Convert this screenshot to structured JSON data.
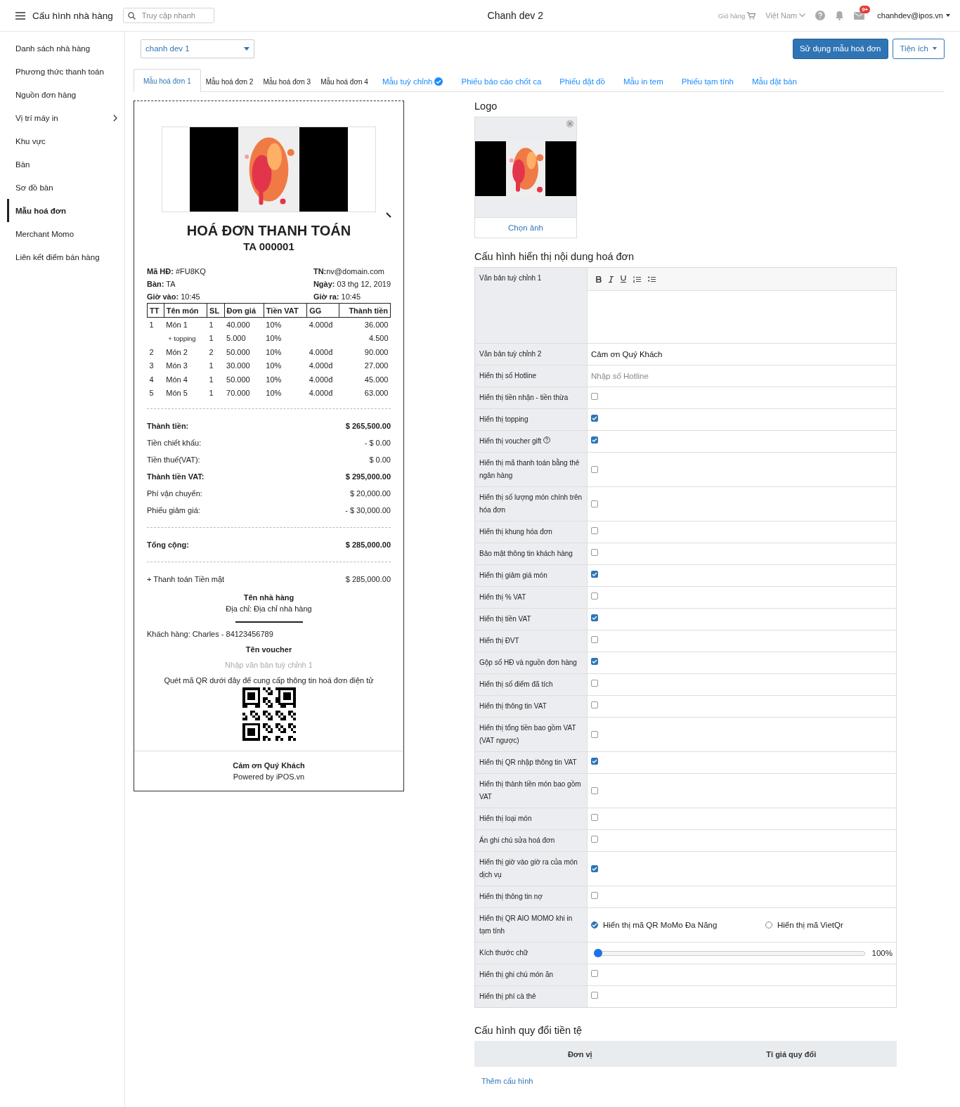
{
  "header": {
    "title": "Cấu hình nhà hàng",
    "search": {
      "placeholder": "Truy cập nhanh"
    },
    "center_title": "Chanh dev 2",
    "cart_label": "Giỏ hàng",
    "language": "Việt Nam",
    "mail_badge": "9+",
    "user": "chanhdev@ipos.vn"
  },
  "sidebar": {
    "items": [
      {
        "label": "Danh sách nhà hàng",
        "selected": false,
        "expandable": false
      },
      {
        "label": "Phương thức thanh toán",
        "selected": false,
        "expandable": false
      },
      {
        "label": "Nguồn đơn hàng",
        "selected": false,
        "expandable": false
      },
      {
        "label": "Vị trí máy in",
        "selected": false,
        "expandable": true
      },
      {
        "label": "Khu vực",
        "selected": false,
        "expandable": false
      },
      {
        "label": "Bàn",
        "selected": false,
        "expandable": false
      },
      {
        "label": "Sơ đồ bàn",
        "selected": false,
        "expandable": false
      },
      {
        "label": "Mẫu hoá đơn",
        "selected": true,
        "expandable": false
      },
      {
        "label": "Merchant Momo",
        "selected": false,
        "expandable": false
      },
      {
        "label": "Liên kết điểm bán hàng",
        "selected": false,
        "expandable": false
      }
    ]
  },
  "toolbar": {
    "store_select": "chanh dev 1",
    "primary_button": "Sử dụng mẫu hoá đơn",
    "utility_button": "Tiện ích"
  },
  "tabs": [
    {
      "label": "Mẫu hoá đơn 1",
      "kind": "template",
      "selected": true,
      "verified": false
    },
    {
      "label": "Mẫu hoá đơn 2",
      "kind": "template",
      "selected": false,
      "verified": false
    },
    {
      "label": "Mẫu hoá đơn 3",
      "kind": "template",
      "selected": false,
      "verified": false
    },
    {
      "label": "Mẫu hoá đơn 4",
      "kind": "template",
      "selected": false,
      "verified": false
    },
    {
      "label": "Mẫu tuỳ chỉnh",
      "kind": "link",
      "selected": false,
      "verified": true
    },
    {
      "label": "Phiếu báo cáo chốt ca",
      "kind": "link",
      "selected": false,
      "verified": false
    },
    {
      "label": "Phiếu đặt đồ",
      "kind": "link",
      "selected": false,
      "verified": false
    },
    {
      "label": "Mẫu in tem",
      "kind": "link",
      "selected": false,
      "verified": false
    },
    {
      "label": "Phiếu tạm tính",
      "kind": "link",
      "selected": false,
      "verified": false
    },
    {
      "label": "Mẫu đặt bàn",
      "kind": "link",
      "selected": false,
      "verified": false
    }
  ],
  "receipt": {
    "title": "HOÁ ĐƠN THANH TOÁN",
    "code": "TA 000001",
    "meta_left": [
      "**Mã HĐ:** #FU8KQ",
      "**Bàn:** TA",
      "**Giờ vào:** 10:45"
    ],
    "meta_right": [
      "**TN:**nv@domain.com",
      "**Ngày:** 03 thg 12, 2019",
      "**Giờ ra:** 10:45"
    ],
    "columns": [
      "TT",
      "Tên món",
      "SL",
      "Đơn giá",
      "Tiền VAT",
      "GG",
      "Thành tiền"
    ],
    "rows": [
      {
        "kind": "item",
        "no": "1",
        "name": "Món 1",
        "qty": "1",
        "price": "40.000",
        "vat": "10%",
        "discount": "4.000đ",
        "total": "36.000"
      },
      {
        "kind": "topping",
        "name": "+ topping",
        "qty": "1",
        "price": "5.000",
        "vat": "10%",
        "total": "4.500"
      },
      {
        "kind": "item",
        "no": "2",
        "name": "Món 2",
        "qty": "2",
        "price": "50.000",
        "vat": "10%",
        "discount": "4.000đ",
        "total": "90.000"
      },
      {
        "kind": "item",
        "no": "3",
        "name": "Món 3",
        "qty": "1",
        "price": "30.000",
        "vat": "10%",
        "discount": "4.000đ",
        "total": "27.000"
      },
      {
        "kind": "item",
        "no": "4",
        "name": "Món 4",
        "qty": "1",
        "price": "50.000",
        "vat": "10%",
        "discount": "4.000đ",
        "total": "45.000"
      },
      {
        "kind": "item",
        "no": "5",
        "name": "Món 5",
        "qty": "1",
        "price": "70.000",
        "vat": "10%",
        "discount": "4.000đ",
        "total": "63.000"
      }
    ],
    "totals": [
      {
        "label": "Thành tiền:",
        "value": "$ 265,500.00",
        "bold": true
      },
      {
        "label": "Tiền chiết khấu:",
        "value": "- $ 0.00",
        "bold": false
      },
      {
        "label": "Tiền thuế(VAT):",
        "value": "$ 0.00",
        "bold": false
      },
      {
        "label": "Thành tiền VAT:",
        "value": "$ 295,000.00",
        "bold": true
      },
      {
        "label": "Phí vận chuyển:",
        "value": "$ 20,000.00",
        "bold": false
      },
      {
        "label": "Phiếu giảm giá:",
        "value": "- $ 30,000.00",
        "bold": false
      }
    ],
    "grand_total": {
      "label": "Tổng cộng:",
      "value": "$ 285,000.00"
    },
    "payment": {
      "label": "+ Thanh toán Tiền mặt",
      "value": "$ 285,000.00"
    },
    "store_name": "Tên nhà hàng",
    "address": "Địa chỉ: Địa chỉ nhà hàng",
    "customer": "Khách hàng: Charles - 84123456789",
    "voucher_name": "Tên voucher",
    "custom_text_placeholder": "Nhập văn bản tuỳ chỉnh 1",
    "qr_caption": "Quét mã QR dưới đây để cung cấp thông tin hoá đơn điện tử",
    "thanks": "Cảm ơn Quý Khách",
    "powered_by": "Powered by iPOS.vn"
  },
  "logo_panel": {
    "heading": "Logo",
    "button": "Chọn ảnh"
  },
  "config": {
    "heading": "Cấu hình hiển thị nội dung hoá đơn",
    "rows": [
      {
        "label": "Văn bản tuỳ chỉnh 1",
        "kind": "editor"
      },
      {
        "label": "Văn bản tuỳ chỉnh 2",
        "kind": "text",
        "value": "Cảm ơn Quý Khách"
      },
      {
        "label": "Hiển thị số Hotline",
        "kind": "input",
        "placeholder": "Nhập số Hotline"
      },
      {
        "label": "Hiển thị tiền nhận - tiền thừa",
        "kind": "checkbox",
        "checked": false,
        "help": false
      },
      {
        "label": "Hiển thị topping",
        "kind": "checkbox",
        "checked": true,
        "help": false
      },
      {
        "label": "Hiển thị voucher gift",
        "kind": "checkbox",
        "checked": true,
        "help": true
      },
      {
        "label": "Hiển thị mã thanh toán bằng thẻ ngân hàng",
        "kind": "checkbox",
        "checked": false,
        "help": false
      },
      {
        "label": "Hiển thị số lượng món chính trên hóa đơn",
        "kind": "checkbox",
        "checked": false,
        "help": false
      },
      {
        "label": "Hiển thị khung hóa đơn",
        "kind": "checkbox",
        "checked": false,
        "help": false
      },
      {
        "label": "Bảo mật thông tin khách hàng",
        "kind": "checkbox",
        "checked": false,
        "help": false
      },
      {
        "label": "Hiển thị giảm giá món",
        "kind": "checkbox",
        "checked": true,
        "help": false
      },
      {
        "label": "Hiển thị % VAT",
        "kind": "checkbox",
        "checked": false,
        "help": false
      },
      {
        "label": "Hiển thị tiền VAT",
        "kind": "checkbox",
        "checked": true,
        "help": false
      },
      {
        "label": "Hiển thị ĐVT",
        "kind": "checkbox",
        "checked": false,
        "help": false
      },
      {
        "label": "Gộp số HĐ và nguồn đơn hàng",
        "kind": "checkbox",
        "checked": true,
        "help": false
      },
      {
        "label": "Hiển thị số điểm đã tích",
        "kind": "checkbox",
        "checked": false,
        "help": false
      },
      {
        "label": "Hiển thị thông tin VAT",
        "kind": "checkbox",
        "checked": false,
        "help": false
      },
      {
        "label": "Hiển thị tổng tiền bao gồm VAT (VAT ngược)",
        "kind": "checkbox",
        "checked": false,
        "help": false
      },
      {
        "label": "Hiển thị QR nhập thông tin VAT",
        "kind": "checkbox",
        "checked": true,
        "help": false
      },
      {
        "label": "Hiển thị thành tiền món bao gồm VAT",
        "kind": "checkbox",
        "checked": false,
        "help": false
      },
      {
        "label": "Hiển thị loại món",
        "kind": "checkbox",
        "checked": false,
        "help": false
      },
      {
        "label": "Ẩn ghi chú sửa hoá đơn",
        "kind": "checkbox",
        "checked": false,
        "help": false
      },
      {
        "label": "Hiển thị giờ vào giờ ra của món dịch vụ",
        "kind": "checkbox",
        "checked": true,
        "help": false
      },
      {
        "label": "Hiển thị thông tin nợ",
        "kind": "checkbox",
        "checked": false,
        "help": false
      },
      {
        "label": "Hiển thị QR AIO MOMO khi in tạm tính",
        "kind": "radio",
        "options": [
          {
            "label": "Hiển thị mã QR MoMo Đa Năng",
            "selected": true
          },
          {
            "label": "Hiển thị mã VietQr",
            "selected": false
          }
        ]
      },
      {
        "label": "Kích thước chữ",
        "kind": "slider",
        "level": 0,
        "reading": "100%"
      },
      {
        "label": "Hiển thị ghi chú món ăn",
        "kind": "checkbox",
        "checked": false,
        "help": false
      },
      {
        "label": "Hiển thị phí cà thẻ",
        "kind": "checkbox",
        "checked": false,
        "help": false
      }
    ]
  },
  "currency": {
    "heading": "Cấu hình quy đổi tiền tệ",
    "columns": [
      "Đơn vị",
      "Tỉ giá quy đổi"
    ],
    "add_link": "Thêm cấu hình"
  }
}
